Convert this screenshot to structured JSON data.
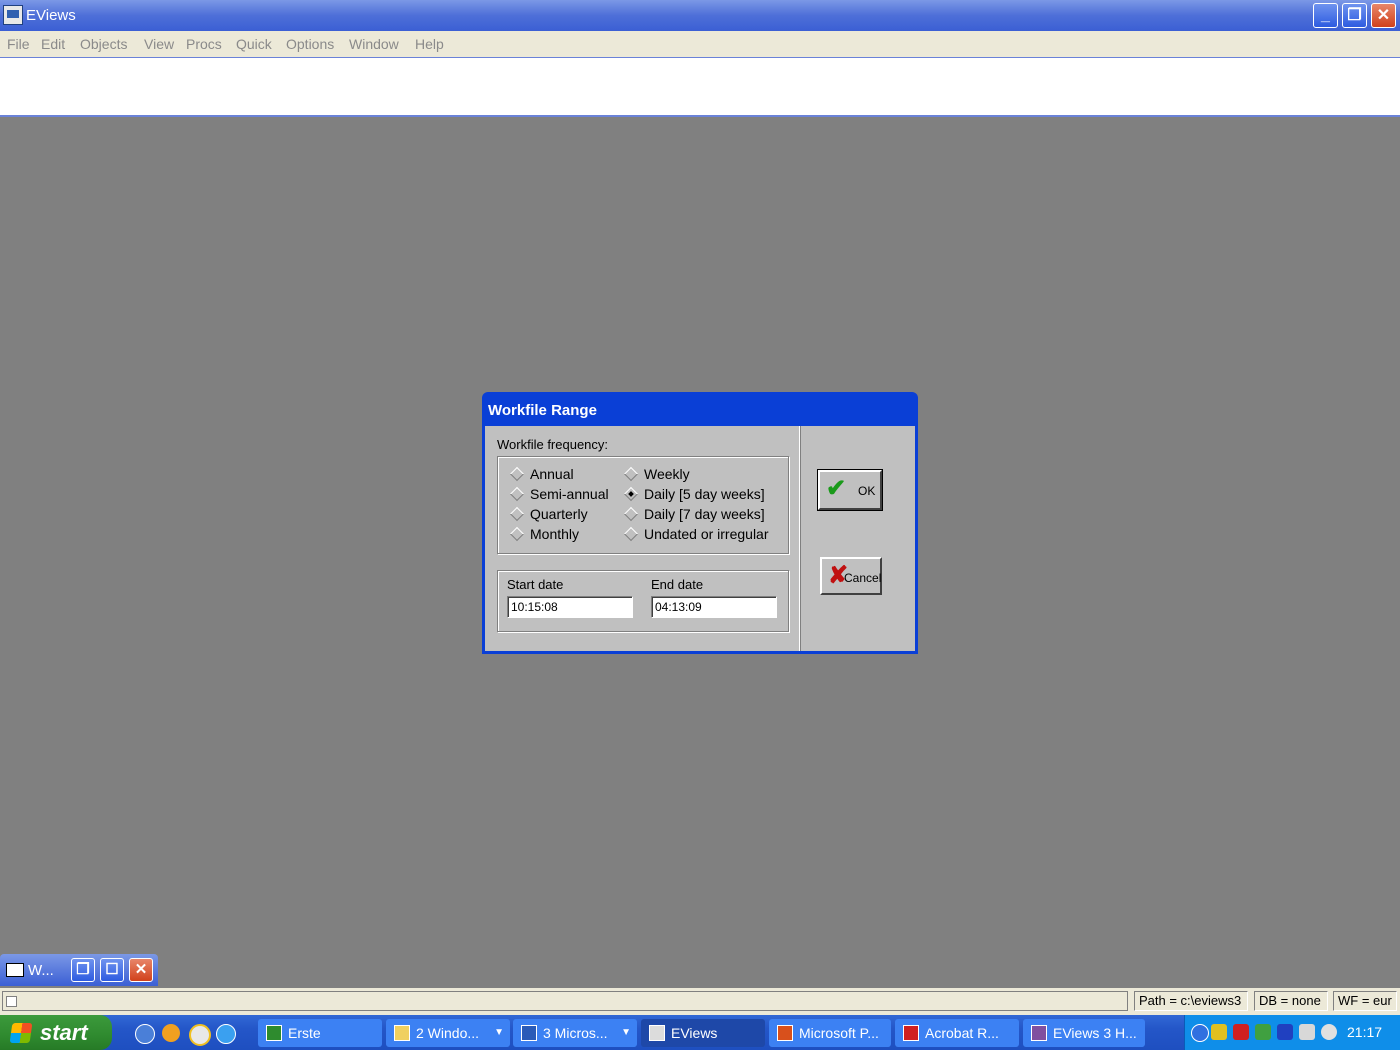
{
  "app": {
    "title": "EViews"
  },
  "menu": [
    "File",
    "Edit",
    "Objects",
    "View",
    "Procs",
    "Quick",
    "Options",
    "Window",
    "Help"
  ],
  "dialog": {
    "title": "Workfile Range",
    "frequency_label": "Workfile frequency:",
    "options_left": [
      "Annual",
      "Semi-annual",
      "Quarterly",
      "Monthly"
    ],
    "options_right": [
      "Weekly",
      "Daily [5 day weeks]",
      "Daily [7 day weeks]",
      "Undated or irregular"
    ],
    "selected": "Daily [5 day weeks]",
    "start_label": "Start date",
    "end_label": "End date",
    "start_value": "10:15:08",
    "end_value": "04:13:09",
    "ok_label": "OK",
    "cancel_label": "Cancel"
  },
  "minimized_window": {
    "title": "W..."
  },
  "status": {
    "path": "Path = c:\\eviews3",
    "db": "DB = none",
    "wf": "WF = eur"
  },
  "taskbar": {
    "start_label": "start",
    "buttons": [
      "Erste",
      "2 Windo...",
      "3 Micros...",
      "EViews",
      "Microsoft P...",
      "Acrobat R...",
      "EViews 3 H..."
    ],
    "clock": "21:17"
  }
}
